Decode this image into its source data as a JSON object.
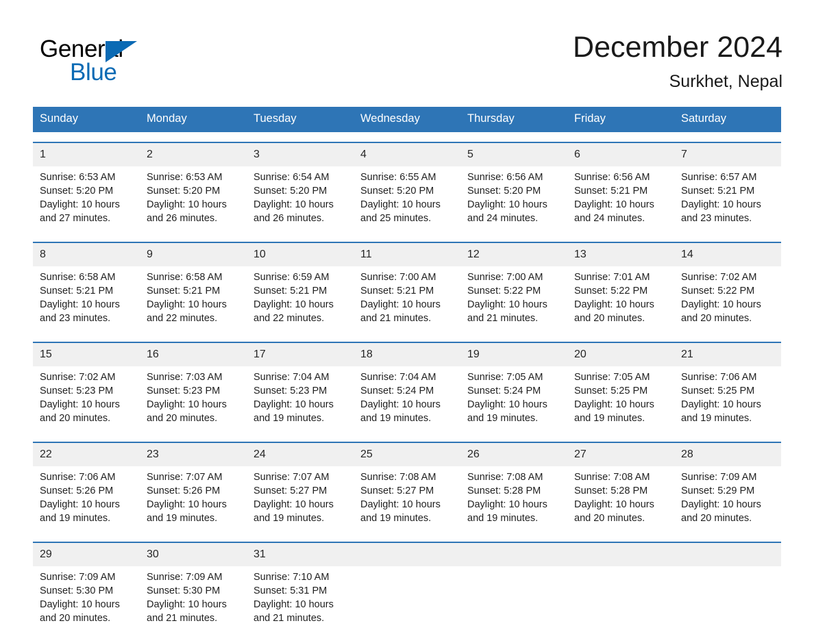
{
  "brand": {
    "logo_general": "General",
    "logo_blue": "Blue",
    "logo_triangle": "triangle-logo-mark",
    "accent_blue": "#0a6ab4"
  },
  "header": {
    "title": "December 2024",
    "location": "Surkhet, Nepal"
  },
  "colors": {
    "header_row": "#2e75b6",
    "date_band": "#f0f0f0",
    "text": "#1a1a1a",
    "page_background": "#ffffff"
  },
  "calendar": {
    "weekday_headers": [
      "Sunday",
      "Monday",
      "Tuesday",
      "Wednesday",
      "Thursday",
      "Friday",
      "Saturday"
    ],
    "weeks": [
      [
        {
          "day": "1",
          "sunrise": "Sunrise: 6:53 AM",
          "sunset": "Sunset: 5:20 PM",
          "daylight_line1": "Daylight: 10 hours",
          "daylight_line2": "and 27 minutes."
        },
        {
          "day": "2",
          "sunrise": "Sunrise: 6:53 AM",
          "sunset": "Sunset: 5:20 PM",
          "daylight_line1": "Daylight: 10 hours",
          "daylight_line2": "and 26 minutes."
        },
        {
          "day": "3",
          "sunrise": "Sunrise: 6:54 AM",
          "sunset": "Sunset: 5:20 PM",
          "daylight_line1": "Daylight: 10 hours",
          "daylight_line2": "and 26 minutes."
        },
        {
          "day": "4",
          "sunrise": "Sunrise: 6:55 AM",
          "sunset": "Sunset: 5:20 PM",
          "daylight_line1": "Daylight: 10 hours",
          "daylight_line2": "and 25 minutes."
        },
        {
          "day": "5",
          "sunrise": "Sunrise: 6:56 AM",
          "sunset": "Sunset: 5:20 PM",
          "daylight_line1": "Daylight: 10 hours",
          "daylight_line2": "and 24 minutes."
        },
        {
          "day": "6",
          "sunrise": "Sunrise: 6:56 AM",
          "sunset": "Sunset: 5:21 PM",
          "daylight_line1": "Daylight: 10 hours",
          "daylight_line2": "and 24 minutes."
        },
        {
          "day": "7",
          "sunrise": "Sunrise: 6:57 AM",
          "sunset": "Sunset: 5:21 PM",
          "daylight_line1": "Daylight: 10 hours",
          "daylight_line2": "and 23 minutes."
        }
      ],
      [
        {
          "day": "8",
          "sunrise": "Sunrise: 6:58 AM",
          "sunset": "Sunset: 5:21 PM",
          "daylight_line1": "Daylight: 10 hours",
          "daylight_line2": "and 23 minutes."
        },
        {
          "day": "9",
          "sunrise": "Sunrise: 6:58 AM",
          "sunset": "Sunset: 5:21 PM",
          "daylight_line1": "Daylight: 10 hours",
          "daylight_line2": "and 22 minutes."
        },
        {
          "day": "10",
          "sunrise": "Sunrise: 6:59 AM",
          "sunset": "Sunset: 5:21 PM",
          "daylight_line1": "Daylight: 10 hours",
          "daylight_line2": "and 22 minutes."
        },
        {
          "day": "11",
          "sunrise": "Sunrise: 7:00 AM",
          "sunset": "Sunset: 5:21 PM",
          "daylight_line1": "Daylight: 10 hours",
          "daylight_line2": "and 21 minutes."
        },
        {
          "day": "12",
          "sunrise": "Sunrise: 7:00 AM",
          "sunset": "Sunset: 5:22 PM",
          "daylight_line1": "Daylight: 10 hours",
          "daylight_line2": "and 21 minutes."
        },
        {
          "day": "13",
          "sunrise": "Sunrise: 7:01 AM",
          "sunset": "Sunset: 5:22 PM",
          "daylight_line1": "Daylight: 10 hours",
          "daylight_line2": "and 20 minutes."
        },
        {
          "day": "14",
          "sunrise": "Sunrise: 7:02 AM",
          "sunset": "Sunset: 5:22 PM",
          "daylight_line1": "Daylight: 10 hours",
          "daylight_line2": "and 20 minutes."
        }
      ],
      [
        {
          "day": "15",
          "sunrise": "Sunrise: 7:02 AM",
          "sunset": "Sunset: 5:23 PM",
          "daylight_line1": "Daylight: 10 hours",
          "daylight_line2": "and 20 minutes."
        },
        {
          "day": "16",
          "sunrise": "Sunrise: 7:03 AM",
          "sunset": "Sunset: 5:23 PM",
          "daylight_line1": "Daylight: 10 hours",
          "daylight_line2": "and 20 minutes."
        },
        {
          "day": "17",
          "sunrise": "Sunrise: 7:04 AM",
          "sunset": "Sunset: 5:23 PM",
          "daylight_line1": "Daylight: 10 hours",
          "daylight_line2": "and 19 minutes."
        },
        {
          "day": "18",
          "sunrise": "Sunrise: 7:04 AM",
          "sunset": "Sunset: 5:24 PM",
          "daylight_line1": "Daylight: 10 hours",
          "daylight_line2": "and 19 minutes."
        },
        {
          "day": "19",
          "sunrise": "Sunrise: 7:05 AM",
          "sunset": "Sunset: 5:24 PM",
          "daylight_line1": "Daylight: 10 hours",
          "daylight_line2": "and 19 minutes."
        },
        {
          "day": "20",
          "sunrise": "Sunrise: 7:05 AM",
          "sunset": "Sunset: 5:25 PM",
          "daylight_line1": "Daylight: 10 hours",
          "daylight_line2": "and 19 minutes."
        },
        {
          "day": "21",
          "sunrise": "Sunrise: 7:06 AM",
          "sunset": "Sunset: 5:25 PM",
          "daylight_line1": "Daylight: 10 hours",
          "daylight_line2": "and 19 minutes."
        }
      ],
      [
        {
          "day": "22",
          "sunrise": "Sunrise: 7:06 AM",
          "sunset": "Sunset: 5:26 PM",
          "daylight_line1": "Daylight: 10 hours",
          "daylight_line2": "and 19 minutes."
        },
        {
          "day": "23",
          "sunrise": "Sunrise: 7:07 AM",
          "sunset": "Sunset: 5:26 PM",
          "daylight_line1": "Daylight: 10 hours",
          "daylight_line2": "and 19 minutes."
        },
        {
          "day": "24",
          "sunrise": "Sunrise: 7:07 AM",
          "sunset": "Sunset: 5:27 PM",
          "daylight_line1": "Daylight: 10 hours",
          "daylight_line2": "and 19 minutes."
        },
        {
          "day": "25",
          "sunrise": "Sunrise: 7:08 AM",
          "sunset": "Sunset: 5:27 PM",
          "daylight_line1": "Daylight: 10 hours",
          "daylight_line2": "and 19 minutes."
        },
        {
          "day": "26",
          "sunrise": "Sunrise: 7:08 AM",
          "sunset": "Sunset: 5:28 PM",
          "daylight_line1": "Daylight: 10 hours",
          "daylight_line2": "and 19 minutes."
        },
        {
          "day": "27",
          "sunrise": "Sunrise: 7:08 AM",
          "sunset": "Sunset: 5:28 PM",
          "daylight_line1": "Daylight: 10 hours",
          "daylight_line2": "and 20 minutes."
        },
        {
          "day": "28",
          "sunrise": "Sunrise: 7:09 AM",
          "sunset": "Sunset: 5:29 PM",
          "daylight_line1": "Daylight: 10 hours",
          "daylight_line2": "and 20 minutes."
        }
      ],
      [
        {
          "day": "29",
          "sunrise": "Sunrise: 7:09 AM",
          "sunset": "Sunset: 5:30 PM",
          "daylight_line1": "Daylight: 10 hours",
          "daylight_line2": "and 20 minutes."
        },
        {
          "day": "30",
          "sunrise": "Sunrise: 7:09 AM",
          "sunset": "Sunset: 5:30 PM",
          "daylight_line1": "Daylight: 10 hours",
          "daylight_line2": "and 21 minutes."
        },
        {
          "day": "31",
          "sunrise": "Sunrise: 7:10 AM",
          "sunset": "Sunset: 5:31 PM",
          "daylight_line1": "Daylight: 10 hours",
          "daylight_line2": "and 21 minutes."
        },
        {
          "day": "",
          "sunrise": "",
          "sunset": "",
          "daylight_line1": "",
          "daylight_line2": ""
        },
        {
          "day": "",
          "sunrise": "",
          "sunset": "",
          "daylight_line1": "",
          "daylight_line2": ""
        },
        {
          "day": "",
          "sunrise": "",
          "sunset": "",
          "daylight_line1": "",
          "daylight_line2": ""
        },
        {
          "day": "",
          "sunrise": "",
          "sunset": "",
          "daylight_line1": "",
          "daylight_line2": ""
        }
      ]
    ]
  }
}
